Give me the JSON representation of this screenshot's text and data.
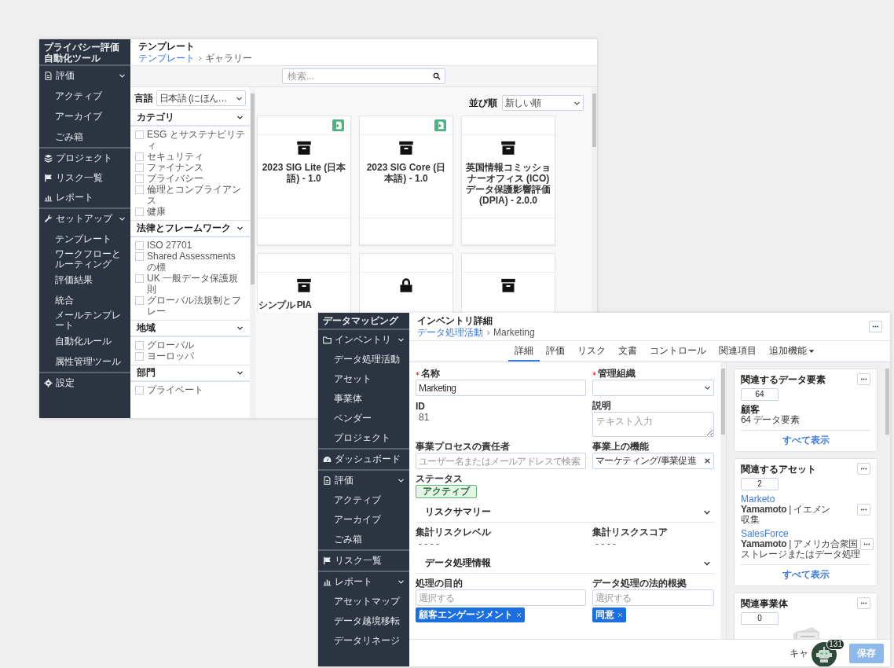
{
  "gallery_window": {
    "sidebar": {
      "title": "プライバシー評価自動化ツール",
      "groups": [
        [
          {
            "label": "評価",
            "expanded": true,
            "children": [
              {
                "label": "アクティブ"
              },
              {
                "label": "アーカイブ"
              },
              {
                "label": "ごみ箱"
              }
            ]
          }
        ],
        [
          {
            "label": "プロジェクト"
          },
          {
            "label": "リスク一覧"
          },
          {
            "label": "レポート"
          }
        ],
        [
          {
            "label": "セットアップ",
            "expanded": true,
            "children": [
              {
                "label": "テンプレート"
              },
              {
                "label": "ワークフローとルーティング"
              },
              {
                "label": "評価結果"
              },
              {
                "label": "統合"
              },
              {
                "label": "メールテンプレート"
              },
              {
                "label": "自動化ルール"
              },
              {
                "label": "属性管理ツール"
              }
            ]
          }
        ],
        [
          {
            "label": "設定"
          }
        ]
      ]
    },
    "header": {
      "title": "テンプレート",
      "breadcrumb": {
        "parent": "テンプレート",
        "current": "ギャラリー"
      }
    },
    "search": {
      "placeholder": "検索..."
    },
    "filters": {
      "language": {
        "label": "言語",
        "value": "日本語 (にほん…"
      },
      "sections": [
        {
          "title": "カテゴリ",
          "expanded": true,
          "options": [
            {
              "label": "ESG とサステナビリティ",
              "checked": false
            },
            {
              "label": "セキュリティ",
              "checked": false
            },
            {
              "label": "ファイナンス",
              "checked": false
            },
            {
              "label": "プライバシー",
              "checked": false
            },
            {
              "label": "倫理とコンプライアンス",
              "checked": false
            },
            {
              "label": "健康",
              "checked": false
            }
          ]
        },
        {
          "title": "法律とフレームワーク",
          "expanded": true,
          "options": [
            {
              "label": "ISO 27701",
              "checked": false
            },
            {
              "label": "Shared Assessments の標",
              "checked": false
            },
            {
              "label": "UK 一般データ保護規則",
              "checked": false
            },
            {
              "label": "グローバル法規制とフレー",
              "checked": false
            }
          ]
        },
        {
          "title": "地域",
          "expanded": true,
          "options": [
            {
              "label": "グローバル",
              "checked": false
            },
            {
              "label": "ヨーロッパ",
              "checked": false
            }
          ]
        },
        {
          "title": "部門",
          "expanded": true,
          "options": [
            {
              "label": "プライベート",
              "checked": false
            }
          ]
        }
      ]
    },
    "sort": {
      "label": "並び順",
      "value": "新しい順"
    },
    "cards": [
      {
        "title": "2023 SIG Lite (日本語) - 1.0",
        "badge": true,
        "kind": "archive"
      },
      {
        "title": "2023 SIG Core (日本語) - 1.0",
        "badge": true,
        "kind": "archive"
      },
      {
        "title": "英国情報コミッショナーオフィス (ICO) データ保護影響評価 (DPIA) - 2.0.0",
        "badge": false,
        "kind": "archive"
      },
      {
        "title": "シンプル PIA",
        "badge": false,
        "kind": "archive"
      },
      {
        "badge": false,
        "kind": "lock"
      },
      {
        "badge": false,
        "kind": "archive"
      }
    ]
  },
  "inventory_window": {
    "sidebar": {
      "title": "データマッピング",
      "groups": [
        [
          {
            "label": "インベントリ",
            "expanded": true,
            "children": [
              {
                "label": "データ処理活動"
              },
              {
                "label": "アセット"
              },
              {
                "label": "事業体"
              },
              {
                "label": "ベンダー"
              },
              {
                "label": "プロジェクト"
              }
            ]
          }
        ],
        [
          {
            "label": "ダッシュボード"
          }
        ],
        [
          {
            "label": "評価",
            "expanded": true,
            "children": [
              {
                "label": "アクティブ"
              },
              {
                "label": "アーカイブ"
              },
              {
                "label": "ごみ箱"
              }
            ]
          }
        ],
        [
          {
            "label": "リスク一覧"
          }
        ],
        [
          {
            "label": "レポート",
            "expanded": true,
            "children": [
              {
                "label": "アセットマップ"
              },
              {
                "label": "データ越境移転"
              },
              {
                "label": "データリネージ"
              }
            ]
          }
        ]
      ]
    },
    "header": {
      "title": "インベントリ詳細",
      "breadcrumb": {
        "parent": "データ処理活動",
        "current": "Marketing"
      }
    },
    "tabs": [
      {
        "label": "詳細",
        "kind": "tab",
        "selected": true
      },
      {
        "label": "評価",
        "kind": "tab",
        "selected": false
      },
      {
        "label": "リスク",
        "kind": "tab",
        "selected": false
      },
      {
        "label": "文書",
        "kind": "tab",
        "selected": false
      },
      {
        "label": "コントロール",
        "kind": "tab",
        "selected": false
      },
      {
        "label": "関連項目",
        "kind": "tab",
        "selected": false
      },
      {
        "label": "追加機能",
        "kind": "dropdown",
        "selected": false
      }
    ],
    "form": [
      {
        "kind": "fields",
        "fields": [
          {
            "kind": "input",
            "label": "名称",
            "required": true,
            "value": "Marketing"
          },
          {
            "kind": "select",
            "label": "管理組織",
            "required": true
          }
        ]
      },
      {
        "kind": "fields",
        "fields": [
          {
            "kind": "text",
            "label": "ID",
            "required": false,
            "value": "81"
          },
          {
            "kind": "textarea",
            "label": "説明",
            "required": false,
            "placeholder": "テキスト入力"
          }
        ]
      },
      {
        "kind": "fields",
        "fields": [
          {
            "kind": "input",
            "label": "事業プロセスの責任者",
            "required": false,
            "placeholder": "ユーザー名またはメールアドレスで検索"
          },
          {
            "kind": "input",
            "label": "事業上の機能",
            "required": false,
            "value": "マーケティング/事業促進",
            "clearable": true
          }
        ]
      },
      {
        "kind": "fields",
        "fields": [
          {
            "kind": "status",
            "label": "ステータス",
            "required": false,
            "value": "アクティブ"
          }
        ]
      },
      {
        "kind": "section",
        "title": "リスクサマリー",
        "expanded": true
      },
      {
        "kind": "fields",
        "fields": [
          {
            "kind": "text",
            "label": "集計リスクレベル",
            "required": false,
            "value": "- - - -"
          },
          {
            "kind": "text",
            "label": "集計リスクスコア",
            "required": false,
            "value": "- - - -"
          }
        ]
      },
      {
        "kind": "section",
        "title": "データ処理情報",
        "expanded": true
      },
      {
        "kind": "fields",
        "fields": [
          {
            "kind": "multiselect",
            "label": "処理の目的",
            "required": false,
            "placeholder": "選択する",
            "chips": [
              "顧客エンゲージメント"
            ]
          },
          {
            "kind": "multiselect",
            "label": "データ処理の法的根拠",
            "required": false,
            "placeholder": "選択する",
            "chips": [
              "同意"
            ]
          }
        ]
      }
    ],
    "related": [
      {
        "title": "関連するデータ要素",
        "count": "64",
        "items": [
          {
            "name": "顧客",
            "link": false,
            "menu": false,
            "lines": [
              "64 データ要素"
            ]
          }
        ],
        "footer": "すべて表示"
      },
      {
        "title": "関連するアセット",
        "count": "2",
        "items": [
          {
            "name": "Marketo",
            "link": true,
            "menu": true,
            "lines": [
              "**Yamamoto** | イエメン",
              "収集"
            ]
          },
          {
            "name": "SalesForce",
            "link": true,
            "menu": true,
            "lines": [
              "**Yamamoto** | アメリカ合衆国",
              "ストレージまたはデータ処理"
            ]
          }
        ],
        "footer": "すべて表示"
      },
      {
        "title": "関連事業体",
        "count": "0",
        "empty": true
      }
    ],
    "footer": {
      "cancel": "キャ",
      "save": "保存",
      "assistant_badge": "131"
    }
  }
}
